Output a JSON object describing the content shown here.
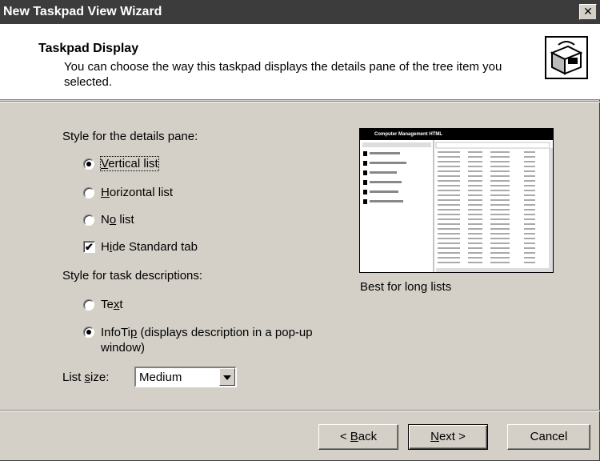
{
  "window": {
    "title": "New Taskpad View Wizard",
    "close_label": "✕"
  },
  "header": {
    "title": "Taskpad Display",
    "description": "You can choose the way this taskpad displays the details pane of the tree item you selected."
  },
  "details_pane": {
    "label": "Style for the details pane:",
    "options": [
      {
        "pre": "",
        "key": "V",
        "post": "ertical list",
        "checked": true
      },
      {
        "pre": "",
        "key": "H",
        "post": "orizontal list",
        "checked": false
      },
      {
        "pre": "N",
        "key": "o",
        "post": " list",
        "checked": false
      }
    ],
    "hide_tab": {
      "pre": "H",
      "key": "i",
      "post": "de Standard tab",
      "checked": true
    }
  },
  "task_desc": {
    "label": "Style for task descriptions:",
    "options": [
      {
        "pre": "Te",
        "key": "x",
        "post": "t",
        "checked": false
      },
      {
        "pre": "InfoTi",
        "key": "p",
        "post": " (displays description in a pop-up",
        "line2": "window)",
        "checked": true
      }
    ]
  },
  "list_size": {
    "pre": "List ",
    "key": "s",
    "post": "ize:",
    "value": "Medium"
  },
  "preview": {
    "title": "Computer Management HTML",
    "caption": "Best for long lists"
  },
  "buttons": {
    "back": {
      "pre": "< ",
      "key": "B",
      "post": "ack"
    },
    "next": {
      "pre": "",
      "key": "N",
      "post": "ext >"
    },
    "cancel": "Cancel"
  }
}
